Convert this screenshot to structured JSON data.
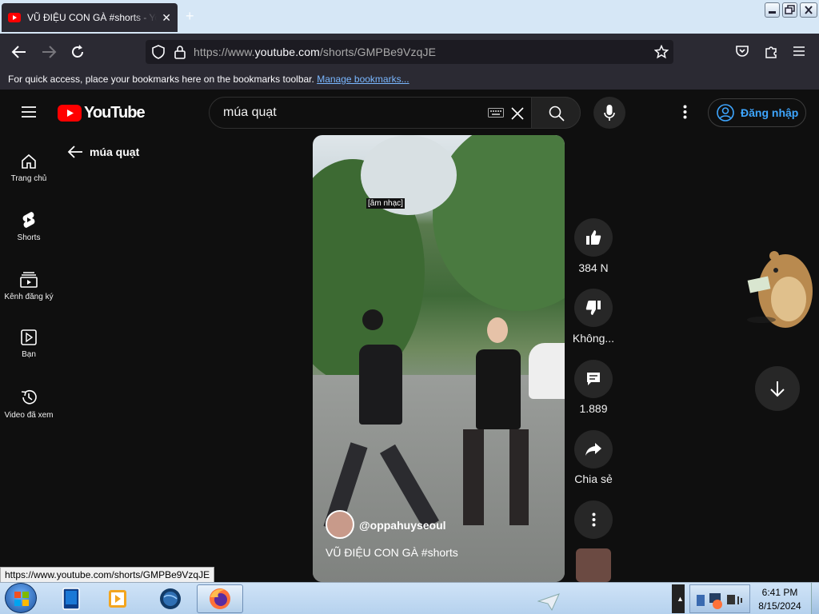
{
  "browser": {
    "tab_title": "VŨ ĐIỆU CON GÀ #shorts - YouTube",
    "url_prefix": "https://www.",
    "url_domain": "youtube.com",
    "url_path": "/shorts/GMPBe9VzqJE",
    "bookmarks_hint": "For quick access, place your bookmarks here on the bookmarks toolbar.",
    "bookmarks_link": "Manage bookmarks...",
    "status_url": "https://www.youtube.com/shorts/GMPBe9VzqJE"
  },
  "youtube": {
    "logo_text": "YouTube",
    "search_query": "múa quạt",
    "sign_in_label": "Đăng nhập",
    "sidebar": [
      {
        "label": "Trang chủ",
        "icon": "home-icon"
      },
      {
        "label": "Shorts",
        "icon": "shorts-icon"
      },
      {
        "label": "Kênh đăng ký",
        "icon": "subscriptions-icon"
      },
      {
        "label": "Bạn",
        "icon": "you-icon"
      },
      {
        "label": "Video đã xem",
        "icon": "history-icon"
      }
    ],
    "back_label": "múa quạt",
    "video": {
      "caption": "[âm nhạc]",
      "channel": "@oppahuyseoul",
      "title": "VŨ ĐIỆU CON GÀ #shorts"
    },
    "actions": {
      "likes": "384 N",
      "dislike": "Không...",
      "comments": "1.889",
      "share": "Chia sẻ"
    },
    "colors": {
      "brand_red": "#ff0000",
      "link_blue": "#3ea6ff"
    }
  },
  "taskbar": {
    "time": "6:41 PM",
    "date": "8/15/2024"
  }
}
